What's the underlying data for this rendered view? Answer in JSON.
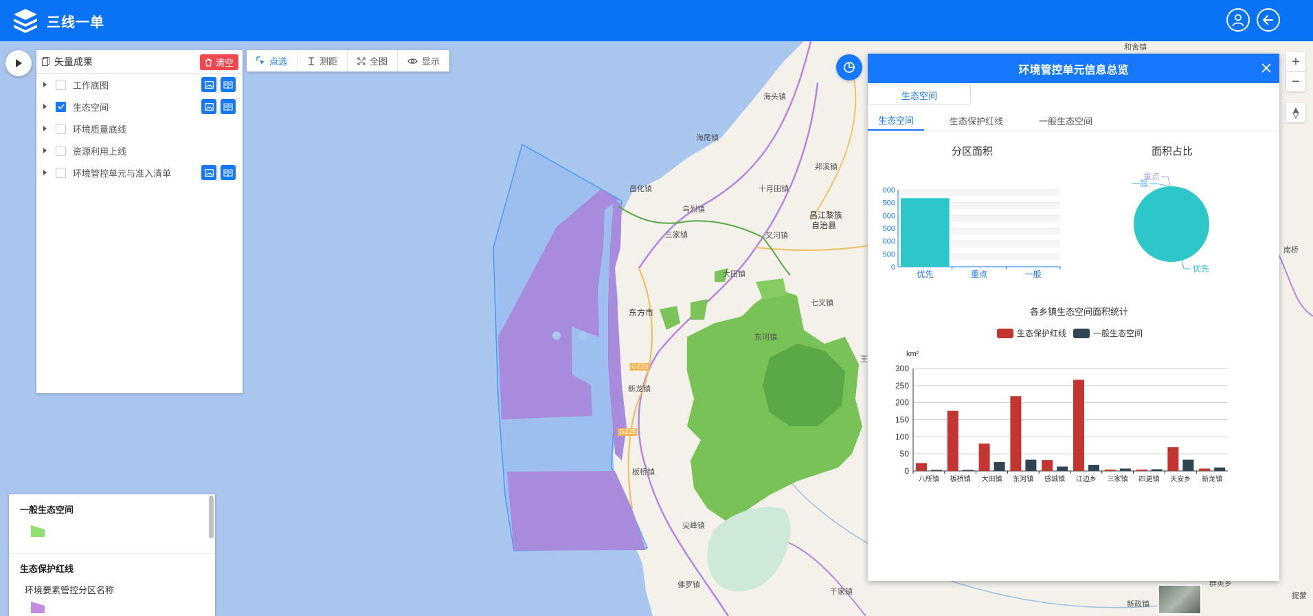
{
  "app": {
    "title": "三线一单"
  },
  "layer_panel": {
    "title": "矢量成果",
    "clear_label": "清空",
    "layers": [
      {
        "label": "工作底图",
        "checked": false,
        "has_buttons": true
      },
      {
        "label": "生态空间",
        "checked": true,
        "has_buttons": true
      },
      {
        "label": "环境质量底线",
        "checked": false,
        "has_buttons": false
      },
      {
        "label": "资源利用上线",
        "checked": false,
        "has_buttons": false
      },
      {
        "label": "环境管控单元与准入清单",
        "checked": false,
        "has_buttons": true
      }
    ]
  },
  "toolbar": {
    "select_label": "点选",
    "measure_label": "测距",
    "fullview_label": "全图",
    "display_label": "显示"
  },
  "legend": {
    "section1_title": "一般生态空间",
    "section1_color": "#8fe06e",
    "section2_title": "生态保护红线",
    "section2_item": "环境要素管控分区名称",
    "section2_color": "#c28de0"
  },
  "map_labels": [
    "海头镇",
    "海尾镇",
    "邦溪镇",
    "昌化镇",
    "十月田镇",
    "乌烈镇",
    "叉河镇",
    "昌江黎族",
    "自治县",
    "三家镇",
    "大田镇",
    "七叉镇",
    "东方市",
    "东河镇",
    "新龙镇",
    "板桥镇",
    "尖峰镇",
    "佛罗镇",
    "千家镇",
    "新政镇",
    "和舍镇",
    "G225",
    "G225",
    "王",
    "南桥",
    "群英乡",
    "提蒙"
  ],
  "info_panel": {
    "title": "环境管控单元信息总览",
    "pill_tab": "生态空间",
    "subtabs": [
      "生态空间",
      "生态保护红线",
      "一般生态空间"
    ],
    "chart1_title": "分区面积",
    "chart2_title": "面积占比",
    "chart3_title": "各乡镇生态空间面积统计"
  },
  "chart_data": [
    {
      "type": "bar",
      "title": "分区面积",
      "categories": [
        "优先",
        "重点",
        "一般"
      ],
      "values": [
        2670,
        0,
        0
      ],
      "ytick_labels": [
        "000",
        "500",
        "000",
        "500",
        "000",
        "500",
        "0"
      ],
      "ylim": [
        0,
        3000
      ],
      "color": "#2ec7c9",
      "grid": true
    },
    {
      "type": "pie",
      "title": "面积占比",
      "labels": [
        "优先",
        "重点",
        "一般"
      ],
      "values": [
        100,
        0,
        0
      ],
      "colors": [
        "#2ec7c9",
        "#b6a2de",
        "#5ab1ef"
      ]
    },
    {
      "type": "bar",
      "title": "各乡镇生态空间面积统计",
      "ylabel": "km²",
      "ylim": [
        0,
        300
      ],
      "yticks": [
        0,
        50,
        100,
        150,
        200,
        250,
        300
      ],
      "categories": [
        "八所镇",
        "板桥镇",
        "大田镇",
        "东河镇",
        "感城镇",
        "江边乡",
        "三家镇",
        "四更镇",
        "天安乡",
        "新龙镇"
      ],
      "series": [
        {
          "name": "生态保护红线",
          "color": "#c23531",
          "values": [
            23,
            176,
            80,
            219,
            32,
            267,
            4,
            4,
            70,
            7
          ]
        },
        {
          "name": "一般生态空间",
          "color": "#2f4554",
          "values": [
            3,
            3,
            26,
            33,
            13,
            18,
            7,
            5,
            33,
            10
          ]
        }
      ],
      "legend_position": "top",
      "grid": true
    }
  ]
}
